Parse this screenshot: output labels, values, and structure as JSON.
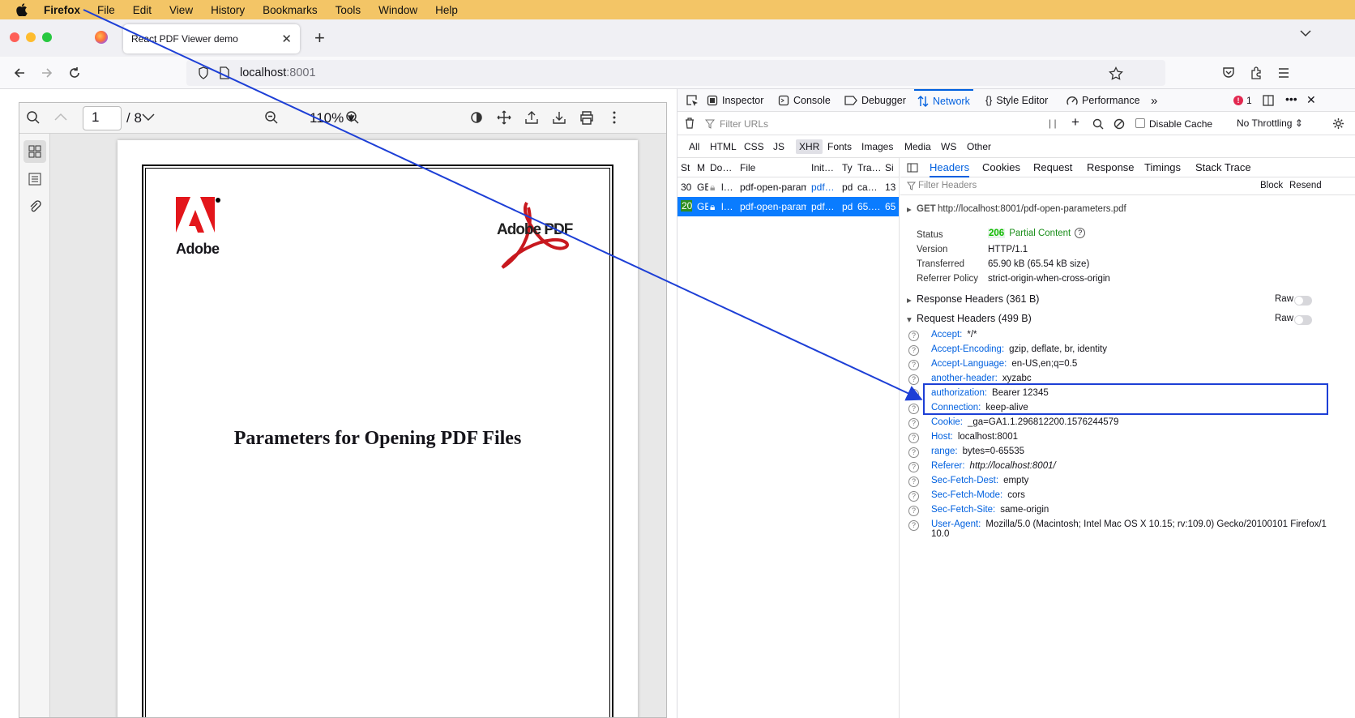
{
  "menubar": {
    "app": "Firefox",
    "items": [
      "File",
      "Edit",
      "View",
      "History",
      "Bookmarks",
      "Tools",
      "Window",
      "Help"
    ]
  },
  "tab": {
    "title": "React PDF Viewer demo"
  },
  "url": {
    "host": "localhost",
    "port": ":8001"
  },
  "viewer": {
    "page": "1",
    "page_count": "/ 8",
    "zoom": "110%"
  },
  "pdf": {
    "logo_text": "Adobe",
    "pdf_logo_text": "Adobe PDF",
    "title": "Parameters for Opening PDF Files"
  },
  "devtools": {
    "tabs": [
      "Inspector",
      "Console",
      "Debugger",
      "Network",
      "Style Editor",
      "Performance"
    ],
    "error_count": "1",
    "filter_placeholder": "Filter URLs",
    "pause": "| |",
    "disable_cache": "Disable Cache",
    "throttling": "No Throttling",
    "types": [
      "All",
      "HTML",
      "CSS",
      "JS",
      "XHR",
      "Fonts",
      "Images",
      "Media",
      "WS",
      "Other"
    ],
    "columns": [
      "St",
      "M",
      "Do…",
      "File",
      "Init…",
      "Ty",
      "Tra…",
      "Si"
    ],
    "rows": [
      {
        "status": "30",
        "method": "GE",
        "domain": "l…",
        "file": "pdf-open-param",
        "init": "pdf…",
        "type": "pd",
        "transferred": "ca…",
        "size": "13"
      },
      {
        "status": "20",
        "method": "GE",
        "domain": "l…",
        "file": "pdf-open-param",
        "init": "pdf…",
        "type": "pd",
        "transferred": "65.…",
        "size": "65"
      }
    ],
    "detail_tabs": [
      "Headers",
      "Cookies",
      "Request",
      "Response",
      "Timings",
      "Stack Trace"
    ],
    "filter_headers": "Filter Headers",
    "block": "Block",
    "resend": "Resend",
    "request_line": {
      "method": "GET",
      "url": "http://localhost:8001/pdf-open-parameters.pdf"
    },
    "summary": {
      "status_label": "Status",
      "status_code": "206",
      "status_text": "Partial Content",
      "version_label": "Version",
      "version": "HTTP/1.1",
      "transferred_label": "Transferred",
      "transferred": "65.90 kB (65.54 kB size)",
      "referrer_label": "Referrer Policy",
      "referrer": "strict-origin-when-cross-origin"
    },
    "response_headers": "Response Headers (361 B)",
    "request_headers": "Request Headers (499 B)",
    "raw": "Raw",
    "headers": [
      {
        "k": "Accept:",
        "v": "*/*"
      },
      {
        "k": "Accept-Encoding:",
        "v": "gzip, deflate, br, identity"
      },
      {
        "k": "Accept-Language:",
        "v": "en-US,en;q=0.5"
      },
      {
        "k": "another-header:",
        "v": "xyzabc"
      },
      {
        "k": "authorization:",
        "v": "Bearer 12345"
      },
      {
        "k": "Connection:",
        "v": "keep-alive"
      },
      {
        "k": "Cookie:",
        "v": "_ga=GA1.1.296812200.1576244579"
      },
      {
        "k": "Host:",
        "v": "localhost:8001"
      },
      {
        "k": "range:",
        "v": "bytes=0-65535"
      },
      {
        "k": "Referer:",
        "v": "http://localhost:8001/"
      },
      {
        "k": "Sec-Fetch-Dest:",
        "v": "empty"
      },
      {
        "k": "Sec-Fetch-Mode:",
        "v": "cors"
      },
      {
        "k": "Sec-Fetch-Site:",
        "v": "same-origin"
      },
      {
        "k": "User-Agent:",
        "v": "Mozilla/5.0 (Macintosh; Intel Mac OS X 10.15; rv:109.0) Gecko/20100101 Firefox/1"
      }
    ],
    "user_agent_wrap": "10.0"
  }
}
